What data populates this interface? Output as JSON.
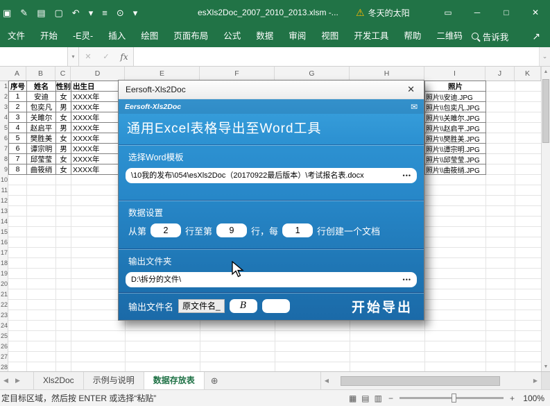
{
  "titlebar": {
    "qat_icons": [
      {
        "name": "save-icon",
        "glyph": "▣"
      },
      {
        "name": "pen-icon",
        "glyph": "✎"
      },
      {
        "name": "paste-icon",
        "glyph": "▤"
      },
      {
        "name": "new-doc-icon",
        "glyph": "▢"
      },
      {
        "name": "undo-icon",
        "glyph": "↶"
      },
      {
        "name": "undo-caret-icon",
        "glyph": "▾"
      },
      {
        "name": "menu-icon",
        "glyph": "≡"
      },
      {
        "name": "zoom-icon",
        "glyph": "⊙"
      },
      {
        "name": "zoom-caret-icon",
        "glyph": "▾"
      }
    ],
    "document_title": "esXls2Doc_2007_2010_2013.xlsm -...",
    "warning_icon": "⚠",
    "warning_text": "冬天的太阳",
    "ribbon_display_icon": "▭",
    "minimize_icon": "─",
    "maximize_icon": "□",
    "close_icon": "✕"
  },
  "ribbon": {
    "tabs": [
      "文件",
      "开始",
      "-E灵-",
      "插入",
      "绘图",
      "页面布局",
      "公式",
      "数据",
      "审阅",
      "视图",
      "开发工具",
      "帮助",
      "二维码"
    ],
    "tell_me": "告诉我",
    "share_icon": "↗"
  },
  "formula_bar": {
    "name_box": "",
    "caret": "▾",
    "cancel_icon": "✕",
    "enter_icon": "✓",
    "fx_label": "fx",
    "formula_value": "",
    "expand_icon": "⌄"
  },
  "grid": {
    "col_letters": [
      "A",
      "B",
      "C",
      "D",
      "E",
      "F",
      "G",
      "H",
      "I",
      "J",
      "K"
    ],
    "header_row": {
      "num": "序号",
      "name": "姓名",
      "gender": "性别",
      "birth": "出生日",
      "photo": "照片"
    },
    "rows": [
      {
        "num": "1",
        "name": "安迪",
        "gender": "女",
        "birth": "XXXX年",
        "photo": "照片\\\\安迪.JPG"
      },
      {
        "num": "2",
        "name": "包奕凡",
        "gender": "男",
        "birth": "XXXX年",
        "photo": "照片\\\\包奕凡.JPG"
      },
      {
        "num": "3",
        "name": "关雎尔",
        "gender": "女",
        "birth": "XXXX年",
        "photo": "照片\\\\关雎尔.JPG"
      },
      {
        "num": "4",
        "name": "赵启平",
        "gender": "男",
        "birth": "XXXX年",
        "photo": "照片\\\\赵启平.JPG"
      },
      {
        "num": "5",
        "name": "樊胜美",
        "gender": "女",
        "birth": "XXXX年",
        "photo": "照片\\\\樊胜美.JPG"
      },
      {
        "num": "6",
        "name": "谭宗明",
        "gender": "男",
        "birth": "XXXX年",
        "photo": "照片\\\\谭宗明.JPG"
      },
      {
        "num": "7",
        "name": "邱莹莹",
        "gender": "女",
        "birth": "XXXX年",
        "photo": "照片\\\\邱莹莹.JPG"
      },
      {
        "num": "8",
        "name": "曲筱绡",
        "gender": "女",
        "birth": "XXXX年",
        "photo": "照片\\\\曲筱绡.JPG"
      }
    ],
    "row_count": 28
  },
  "dialog": {
    "window_title": "Eersoft-Xls2Doc",
    "close_icon": "✕",
    "brand": "Eersoft-Xls2Doc",
    "mail_icon": "✉",
    "heading": "通用Excel表格导出至Word工具",
    "template_label": "选择Word模板",
    "template_path": "\\10我的发布\\054\\esXls2Doc（20170922最后版本）\\考试报名表.docx",
    "browse_dots": "•••",
    "data_section_label": "数据设置",
    "from_label": "从第",
    "from_value": "2",
    "to_label": "行至第",
    "to_value": "9",
    "every_label": "行，每",
    "every_value": "1",
    "per_doc_label": "行创建一个文档",
    "output_folder_label": "输出文件夹",
    "output_folder_value": "D:\\拆分的文件\\",
    "output_name_label": "输出文件名",
    "orig_name_label": "原文件名_",
    "suffix_value": "B",
    "suffix2_value": "",
    "start_button": "开始导出"
  },
  "sheet_tabs": {
    "tabs": [
      {
        "label": "Xls2Doc",
        "active": false
      },
      {
        "label": "示例与说明",
        "active": false
      },
      {
        "label": "数据存放表",
        "active": true
      }
    ],
    "add_sheet_icon": "⊕"
  },
  "scrollbars": {
    "up_icon": "▲",
    "down_icon": "▼",
    "left_icon": "◀",
    "right_icon": "▶"
  },
  "status_bar": {
    "message": "定目标区域，然后按 ENTER 或选择“粘贴”",
    "view_icons": [
      {
        "name": "normal-view-icon",
        "glyph": "▦"
      },
      {
        "name": "page-layout-view-icon",
        "glyph": "▤"
      },
      {
        "name": "page-break-view-icon",
        "glyph": "▥"
      }
    ],
    "zoom_out_icon": "−",
    "zoom_in_icon": "+",
    "zoom_level": "100%"
  },
  "colors": {
    "excel_green": "#217346",
    "warning_orange": "#ffb900",
    "dialog_blue_top": "#3aa2de",
    "dialog_blue_bottom": "#1b6aa8",
    "active_tab_green": "#1e7145"
  }
}
